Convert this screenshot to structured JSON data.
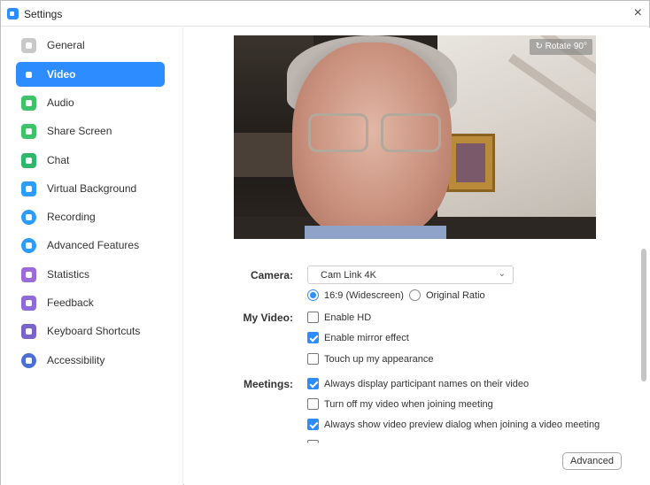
{
  "window": {
    "title": "Settings",
    "close_glyph": "×"
  },
  "sidebar": {
    "items": [
      {
        "label": "General",
        "icon": "gear-icon",
        "color": "#c9c9c9",
        "active": false
      },
      {
        "label": "Video",
        "icon": "video-icon",
        "color": "#2d8cff",
        "active": true
      },
      {
        "label": "Audio",
        "icon": "headphones-icon",
        "color": "#3ec36b",
        "active": false
      },
      {
        "label": "Share Screen",
        "icon": "share-screen-icon",
        "color": "#3ec36b",
        "active": false
      },
      {
        "label": "Chat",
        "icon": "chat-icon",
        "color": "#2fb86b",
        "active": false
      },
      {
        "label": "Virtual Background",
        "icon": "virtual-background-icon",
        "color": "#2d9cff",
        "active": false
      },
      {
        "label": "Recording",
        "icon": "recording-icon",
        "color": "#2d9cff",
        "active": false
      },
      {
        "label": "Advanced Features",
        "icon": "advanced-features-icon",
        "color": "#2d9cff",
        "active": false
      },
      {
        "label": "Statistics",
        "icon": "statistics-icon",
        "color": "#9c6bd8",
        "active": false
      },
      {
        "label": "Feedback",
        "icon": "feedback-icon",
        "color": "#8e6bd8",
        "active": false
      },
      {
        "label": "Keyboard Shortcuts",
        "icon": "keyboard-icon",
        "color": "#7a63c9",
        "active": false
      },
      {
        "label": "Accessibility",
        "icon": "accessibility-icon",
        "color": "#4a6fd6",
        "active": false
      }
    ]
  },
  "preview": {
    "rotate_label": "↻ Rotate 90°"
  },
  "camera": {
    "label": "Camera:",
    "selected": "Cam Link 4K",
    "ratio_options": [
      {
        "label": "16:9 (Widescreen)",
        "selected": true
      },
      {
        "label": "Original Ratio",
        "selected": false
      }
    ]
  },
  "my_video": {
    "label": "My Video:",
    "options": [
      {
        "label": "Enable HD",
        "checked": false
      },
      {
        "label": "Enable mirror effect",
        "checked": true
      },
      {
        "label": "Touch up my appearance",
        "checked": false
      }
    ]
  },
  "meetings": {
    "label": "Meetings:",
    "options": [
      {
        "label": "Always display participant names on their video",
        "checked": true
      },
      {
        "label": "Turn off my video when joining meeting",
        "checked": false
      },
      {
        "label": "Always show video preview dialog when joining a video meeting",
        "checked": true
      }
    ]
  },
  "advanced_button": "Advanced",
  "colors": {
    "accent": "#2d8cff"
  }
}
